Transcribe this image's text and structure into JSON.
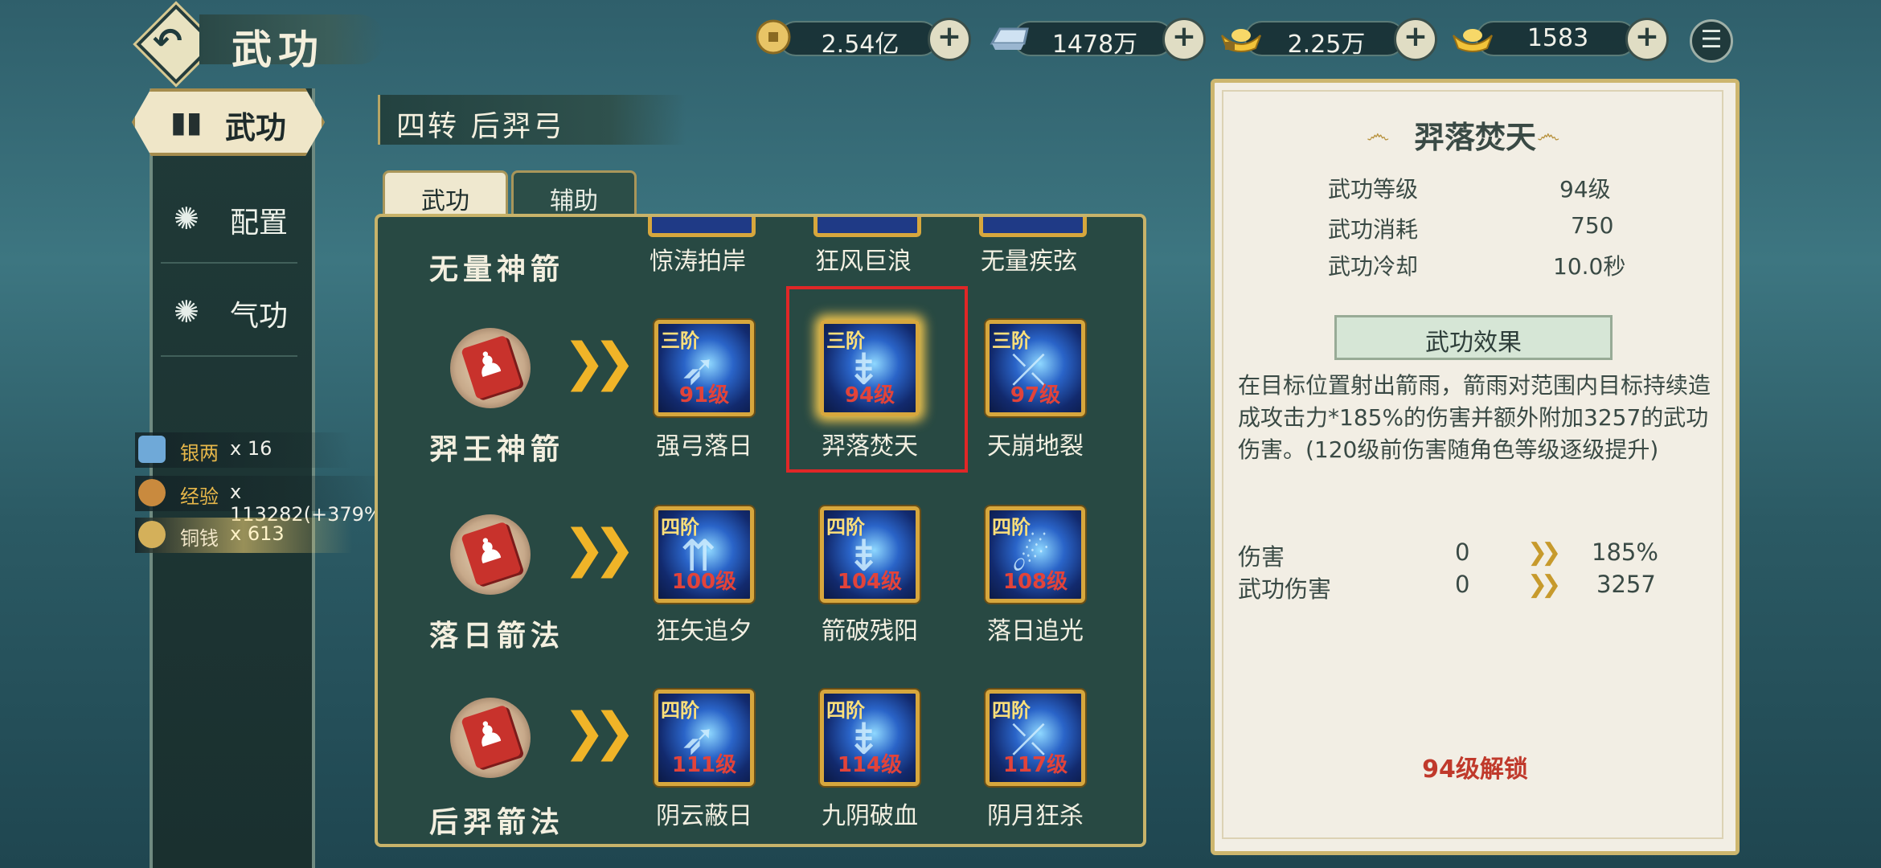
{
  "header": {
    "title": "武功",
    "currencies": [
      {
        "icon": "coin-icon",
        "value": "2.54亿"
      },
      {
        "icon": "silver-ingot-icon",
        "value": "1478万"
      },
      {
        "icon": "gold-ingot-lock-icon",
        "value": "2.25万"
      },
      {
        "icon": "gold-ingot-icon",
        "value": "1583"
      }
    ]
  },
  "sidebar": {
    "active": "武功",
    "items": [
      "配置",
      "气功"
    ]
  },
  "rewards": [
    {
      "icon": "silver-icon",
      "label": "银两",
      "value": "x 16"
    },
    {
      "icon": "exp-icon",
      "label": "经验",
      "value": "x 113282(+379%)"
    },
    {
      "icon": "copper-icon",
      "label": "铜钱",
      "value": "x 613"
    }
  ],
  "section": {
    "title": "四转 后羿弓"
  },
  "tabs": [
    "武功",
    "辅助"
  ],
  "skill_rows": [
    {
      "label": "无量神箭",
      "skills": [
        {
          "name": "惊涛拍岸"
        },
        {
          "name": "狂风巨浪"
        },
        {
          "name": "无量疾弦"
        }
      ]
    },
    {
      "label": "羿王神箭",
      "skills": [
        {
          "stage": "三阶",
          "level": "91级",
          "name": "强弓落日"
        },
        {
          "stage": "三阶",
          "level": "94级",
          "name": "羿落焚天"
        },
        {
          "stage": "三阶",
          "level": "97级",
          "name": "天崩地裂"
        }
      ]
    },
    {
      "label": "落日箭法",
      "skills": [
        {
          "stage": "四阶",
          "level": "100级",
          "name": "狂矢追夕"
        },
        {
          "stage": "四阶",
          "level": "104级",
          "name": "箭破残阳"
        },
        {
          "stage": "四阶",
          "level": "108级",
          "name": "落日追光"
        }
      ]
    },
    {
      "label": "后羿箭法",
      "skills": [
        {
          "stage": "四阶",
          "level": "111级",
          "name": "阴云蔽日"
        },
        {
          "stage": "四阶",
          "level": "114级",
          "name": "九阴破血"
        },
        {
          "stage": "四阶",
          "level": "117级",
          "name": "阴月狂杀"
        }
      ]
    }
  ],
  "detail": {
    "title": "羿落焚天",
    "stats": [
      {
        "label": "武功等级",
        "value": "94级"
      },
      {
        "label": "武功消耗",
        "value": "750"
      },
      {
        "label": "武功冷却",
        "value": "10.0秒"
      }
    ],
    "effect_header": "武功效果",
    "description": "在目标位置射出箭雨，箭雨对范围内目标持续造成攻击力*185%的伤害并额外附加3257的武功伤害。(120级前伤害随角色等级逐级提升)",
    "damage": [
      {
        "label": "伤害",
        "from": "0",
        "to": "185%"
      },
      {
        "label": "武功伤害",
        "from": "0",
        "to": "3257"
      }
    ],
    "unlock": "94级解锁"
  },
  "colors": {
    "accent_gold": "#c8b36a",
    "level_red": "#e2433a",
    "selection_red": "#e02727"
  }
}
